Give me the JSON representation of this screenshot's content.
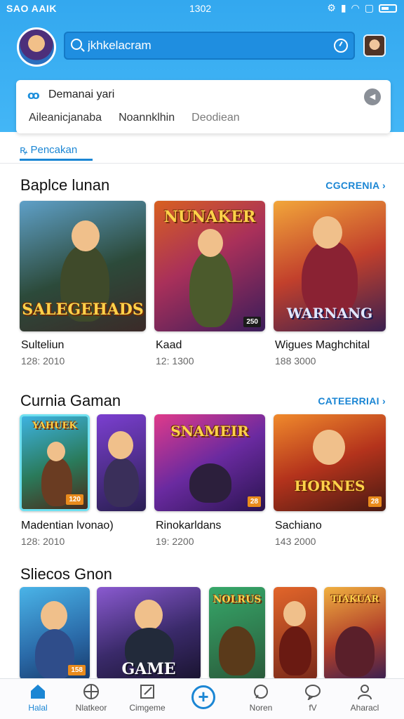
{
  "status_bar": {
    "carrier": "SAO AAIK",
    "time": "1302"
  },
  "header": {
    "search_value": "jkhkelacram"
  },
  "filter_card": {
    "title": "Demanai yari",
    "tabs": [
      "Aileanicjanaba",
      "Noannklhin",
      "Deodiean"
    ]
  },
  "subtab": {
    "label": "Pencakan"
  },
  "sections": [
    {
      "title": "Baplce lunan",
      "link": "CGCRENIA",
      "items": [
        {
          "name": "Sulteliun",
          "meta": "128: 2010",
          "art_text": "SALEGEHADS",
          "badge": ""
        },
        {
          "name": "Kaad",
          "meta": "12: 1300",
          "art_text": "NUNAKER",
          "badge": "250"
        },
        {
          "name": "Wigues Maghchital",
          "meta": "188 3000",
          "art_text": "WARNANG",
          "badge": ""
        }
      ]
    },
    {
      "title": "Curnia Gaman",
      "link": "CATEERRIAI",
      "items": [
        {
          "name": "Madentian lvonao)",
          "meta": "128: 2010",
          "art_text": "YAHUEK",
          "badge": "120"
        },
        {
          "name": "Rinokarldans",
          "meta": "19: 2200",
          "art_text": "SNAMEIR",
          "badge": "28"
        },
        {
          "name": "Sachiano",
          "meta": "143 2000",
          "art_text": "HORNES",
          "badge": "28"
        }
      ]
    },
    {
      "title": "Sliecos Gnon",
      "link": "",
      "items": [
        {
          "name": "",
          "meta": "",
          "art_text": "",
          "badge": "158"
        },
        {
          "name": "",
          "meta": "",
          "art_text": "GAME",
          "badge": ""
        },
        {
          "name": "",
          "meta": "",
          "art_text": "NOLRUS",
          "badge": ""
        },
        {
          "name": "",
          "meta": "",
          "art_text": "",
          "badge": ""
        },
        {
          "name": "",
          "meta": "",
          "art_text": "TIAKUAR",
          "badge": ""
        }
      ]
    }
  ],
  "bottom_nav": [
    {
      "label": "Halal",
      "icon": "home-icon",
      "active": true
    },
    {
      "label": "Nlatkeor",
      "icon": "globe-icon",
      "active": false
    },
    {
      "label": "Cimgeme",
      "icon": "edit-icon",
      "active": false
    },
    {
      "label": "Noren",
      "icon": "notification-icon",
      "active": false
    },
    {
      "label": "fV",
      "icon": "chat-icon",
      "active": false
    },
    {
      "label": "Aharacl",
      "icon": "profile-icon",
      "active": false
    }
  ],
  "colors": {
    "primary": "#1b86d4",
    "header_bg": "#3aaef3",
    "badge": "#e98b1c"
  }
}
